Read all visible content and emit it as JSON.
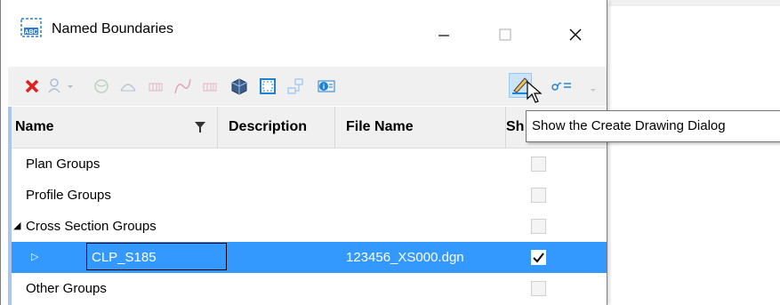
{
  "window": {
    "title": "Named Boundaries",
    "controls": {
      "minimize": "—",
      "maximize": "☐",
      "close": "✕"
    }
  },
  "toolbar": {
    "items": [
      {
        "name": "delete-button",
        "icon": "red-x-icon",
        "enabled": true
      },
      {
        "name": "filter-person-button",
        "icon": "person-filter-icon",
        "enabled": false
      },
      {
        "name": "dropdown-arrow",
        "icon": "chevron-down-icon",
        "enabled": false
      },
      {
        "name": "boundary-button",
        "icon": "globe-icon",
        "enabled": false
      },
      {
        "name": "profile-button",
        "icon": "arc-icon",
        "enabled": false
      },
      {
        "name": "grid-button",
        "icon": "grid-icon",
        "enabled": false
      },
      {
        "name": "curve-button",
        "icon": "curve-icon",
        "enabled": false
      },
      {
        "name": "grid2-button",
        "icon": "grid-icon",
        "enabled": false
      },
      {
        "name": "cube-button",
        "icon": "cube-icon",
        "enabled": true
      },
      {
        "name": "frame-button",
        "icon": "frame-icon",
        "enabled": true
      },
      {
        "name": "structure-button",
        "icon": "structure-icon",
        "enabled": false
      },
      {
        "name": "info-button",
        "icon": "info-icon",
        "enabled": true
      },
      {
        "name": "create-drawing-button",
        "icon": "pencil-icon",
        "enabled": true
      },
      {
        "name": "settings-button",
        "icon": "sigma-icon",
        "enabled": true
      },
      {
        "name": "overflow-button",
        "icon": "chevron-down-icon",
        "enabled": false
      }
    ]
  },
  "table": {
    "columns": [
      "Name",
      "Description",
      "File Name",
      "Sh"
    ],
    "rows": [
      {
        "name": "Plan Groups",
        "description": "",
        "file": "",
        "checked": false,
        "expander": "",
        "selected": false
      },
      {
        "name": "Profile Groups",
        "description": "",
        "file": "",
        "checked": false,
        "expander": "",
        "selected": false
      },
      {
        "name": "Cross Section Groups",
        "description": "",
        "file": "",
        "checked": false,
        "expander": "◢",
        "selected": false
      },
      {
        "name": "CLP_S185",
        "description": "",
        "file": "123456_XS000.dgn",
        "checked": true,
        "expander": "▷",
        "selected": true
      },
      {
        "name": "Other Groups",
        "description": "",
        "file": "",
        "checked": false,
        "expander": "",
        "selected": false
      }
    ]
  },
  "tooltip": {
    "text": "Show the Create Drawing Dialog"
  },
  "colors": {
    "selection": "#3399ff",
    "header_bg": "#f0f0f0",
    "left_accent": "#a6c8ee"
  }
}
